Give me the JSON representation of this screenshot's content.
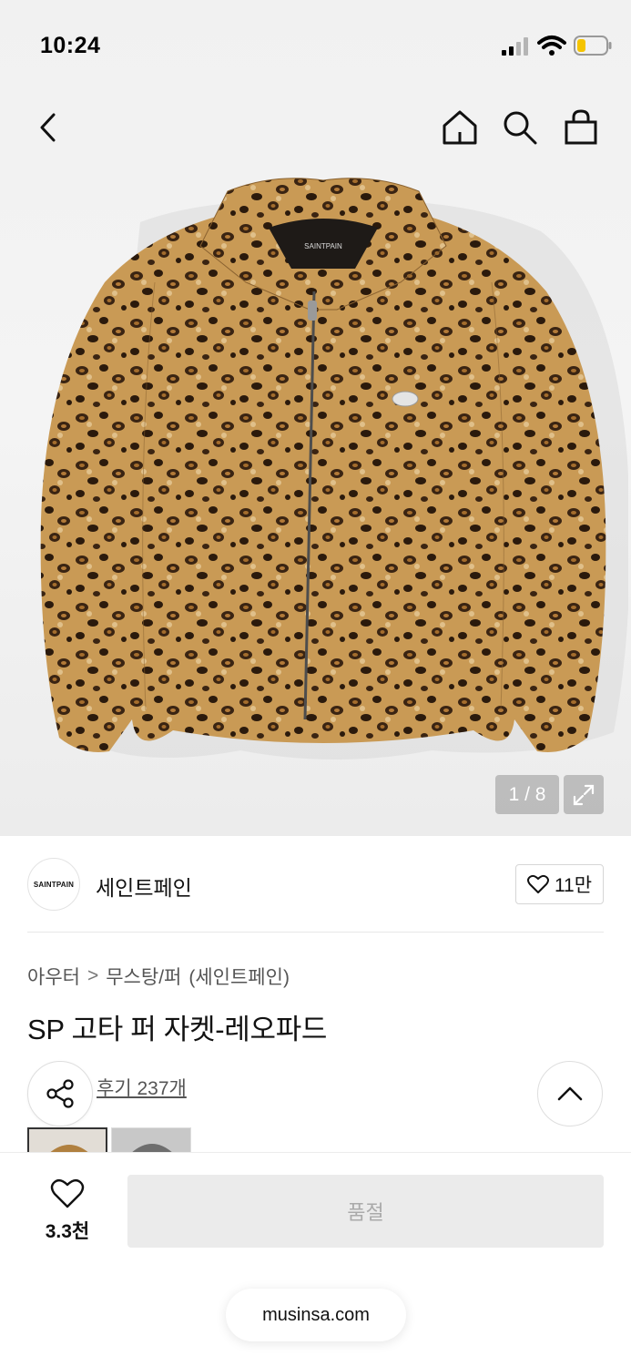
{
  "status_bar": {
    "time": "10:24"
  },
  "gallery": {
    "counter": "1 / 8"
  },
  "brand": {
    "logo_text": "SAINTPAIN",
    "name": "세인트페인",
    "likes": "11만"
  },
  "breadcrumb": {
    "category": "아우터",
    "separator": ">",
    "subcategory": "무스탕/퍼",
    "brand": "(세인트페인)"
  },
  "product": {
    "title": "SP 고타 퍼 자켓-레오파드",
    "reviews_label": "후기 237개"
  },
  "bottom_bar": {
    "wish_count": "3.3천",
    "soldout_label": "품절"
  },
  "browser": {
    "url": "musinsa.com"
  },
  "colors": {
    "accent": "#111111",
    "soldout_bg": "#ebebeb",
    "soldout_text": "#aaaaaa"
  },
  "icons": [
    "back-icon",
    "home-icon",
    "search-icon",
    "bag-icon",
    "expand-icon",
    "heart-icon",
    "share-icon",
    "chevron-up-icon"
  ]
}
